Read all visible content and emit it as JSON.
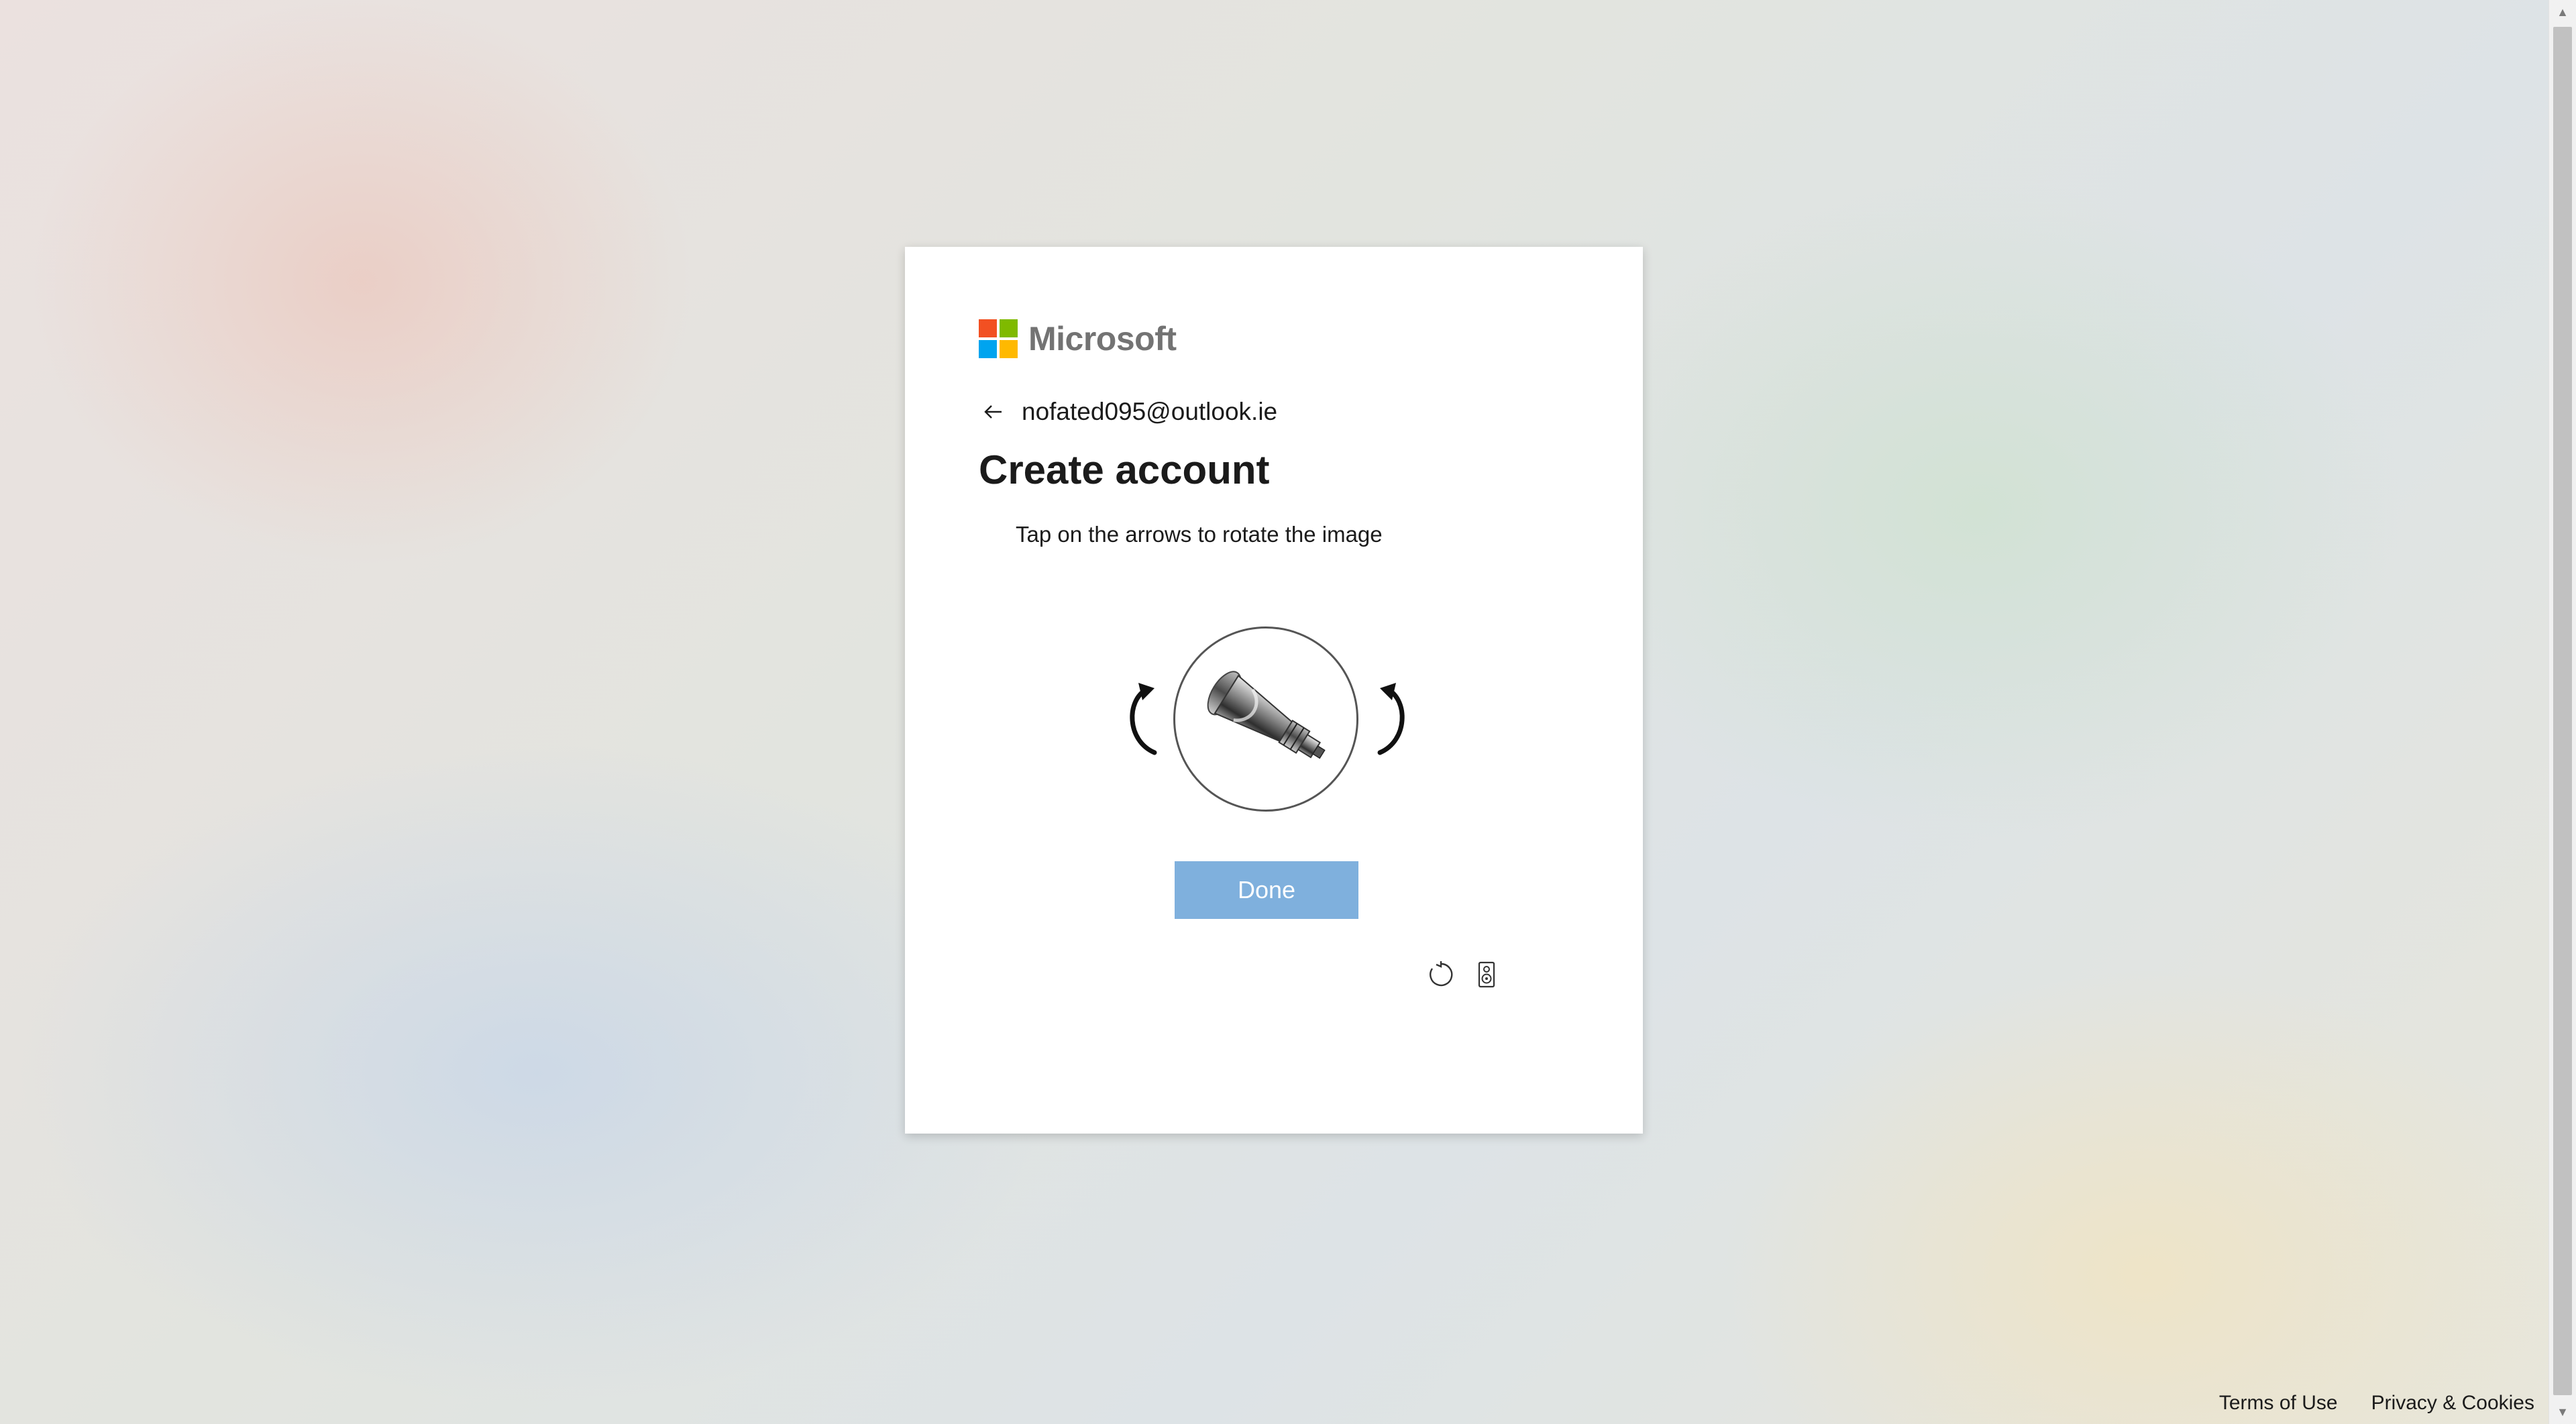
{
  "brand": {
    "name": "Microsoft",
    "logo_icon": "microsoft-four-squares-icon",
    "logo_colors": [
      "#f25022",
      "#7fba00",
      "#00a4ef",
      "#ffb900"
    ]
  },
  "identity": {
    "back_icon": "back-arrow-icon",
    "email": "nofated095@outlook.ie"
  },
  "main": {
    "title": "Create account",
    "instruction": "Tap on the arrows to rotate the image",
    "rotate_left_icon": "rotate-counterclockwise-icon",
    "rotate_right_icon": "rotate-clockwise-icon",
    "puzzle_image_icon": "rotated-object-icon",
    "done_label": "Done",
    "accent_color": "#7fb0dd"
  },
  "tools": {
    "refresh_icon": "refresh-icon",
    "audio_icon": "audio-speaker-icon"
  },
  "footer": {
    "terms": "Terms of Use",
    "privacy": "Privacy & Cookies"
  }
}
